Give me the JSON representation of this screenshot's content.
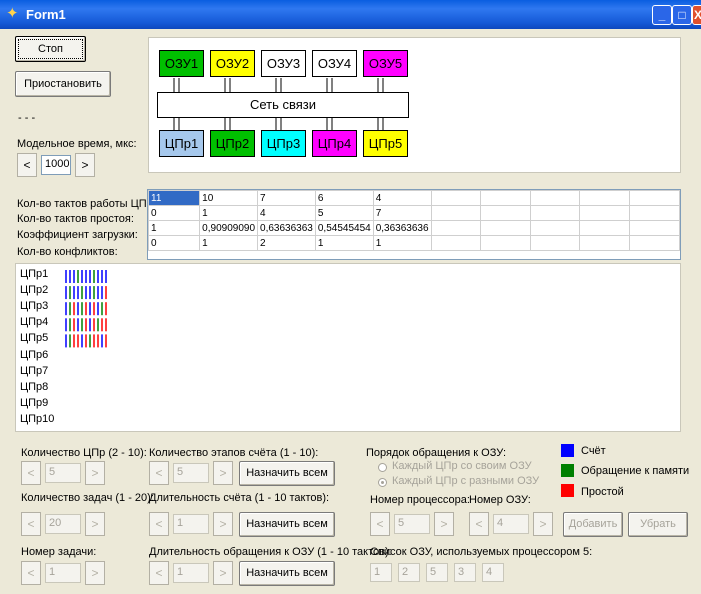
{
  "window": {
    "title": "Form1",
    "min": "_",
    "max": "□",
    "close": "X"
  },
  "controls": {
    "stop": "Стоп",
    "pause": "Приостановить",
    "dashes": "- - -",
    "model_time_label": "Модельное время, мкс:",
    "model_time_value": "1000",
    "dec": "<",
    "inc": ">"
  },
  "diagram": {
    "ram": [
      "ОЗУ1",
      "ОЗУ2",
      "ОЗУ3",
      "ОЗУ4",
      "ОЗУ5"
    ],
    "ram_colors": [
      "#00c000",
      "#ffff00",
      "#ffffff",
      "#ffffff",
      "#ff00ff"
    ],
    "network": "Сеть связи",
    "cpu": [
      "ЦПр1",
      "ЦПр2",
      "ЦПр3",
      "ЦПр4",
      "ЦПр5"
    ],
    "cpu_colors": [
      "#a6c8ec",
      "#00c000",
      "#00ffff",
      "#ff00ff",
      "#ffff00"
    ]
  },
  "stats": {
    "row_labels": [
      "Кол-во тактов работы ЦПр:",
      "Кол-во тактов простоя:",
      "Коэффициент загрузки:",
      "Кол-во конфликтов:"
    ],
    "rows": [
      [
        "11",
        "10",
        "7",
        "6",
        "4",
        "",
        "",
        "",
        "",
        ""
      ],
      [
        "0",
        "1",
        "4",
        "5",
        "7",
        "",
        "",
        "",
        "",
        ""
      ],
      [
        "1",
        "0,90909090",
        "0,63636363",
        "0,54545454",
        "0,36363636",
        "",
        "",
        "",
        "",
        ""
      ],
      [
        "0",
        "1",
        "2",
        "1",
        "1",
        "",
        "",
        "",
        "",
        ""
      ]
    ]
  },
  "timeline": {
    "labels": [
      "ЦПр1",
      "ЦПр2",
      "ЦПр3",
      "ЦПр4",
      "ЦПр5",
      "ЦПр6",
      "ЦПр7",
      "ЦПр8",
      "ЦПр9",
      "ЦПр10"
    ],
    "sequences": [
      [
        "c",
        "c",
        "c",
        "m",
        "c",
        "c",
        "c",
        "m",
        "c",
        "c",
        "c"
      ],
      [
        "c",
        "m",
        "c",
        "c",
        "m",
        "c",
        "c",
        "m",
        "c",
        "c",
        "i"
      ],
      [
        "c",
        "m",
        "i",
        "c",
        "m",
        "i",
        "c",
        "i",
        "c",
        "m",
        "i"
      ],
      [
        "c",
        "m",
        "i",
        "c",
        "m",
        "i",
        "c",
        "i",
        "m",
        "i",
        "i"
      ],
      [
        "c",
        "m",
        "i",
        "i",
        "c",
        "i",
        "m",
        "i",
        "i",
        "c",
        "i"
      ]
    ]
  },
  "legend": [
    {
      "label": "Счёт",
      "color": "#0000ff"
    },
    {
      "label": "Обращение к памяти",
      "color": "#008000"
    },
    {
      "label": "Простой",
      "color": "#ff0000"
    }
  ],
  "settings": {
    "cpu_count_label": "Количество ЦПр (2 - 10):",
    "cpu_count": "5",
    "task_count_label": "Количество задач (1 - 20):",
    "task_count": "20",
    "task_num_label": "Номер задачи:",
    "task_num": "1",
    "stages_label": "Количество этапов счёта (1 - 10):",
    "stages": "5",
    "calc_dur_label": "Длительность счёта (1 - 10 тактов):",
    "calc_dur": "1",
    "mem_dur_label": "Длительность обращения к ОЗУ (1 - 10 тактов):",
    "mem_dur": "1",
    "assign_all": "Назначить всем",
    "order_label": "Порядок обращения к ОЗУ:",
    "order_opt1": "Каждый ЦПр со своим ОЗУ",
    "order_opt2": "Каждый ЦПр с разными ОЗУ",
    "proc_num_label": "Номер процессора:",
    "proc_num": "5",
    "ram_num_label": "Номер ОЗУ:",
    "ram_num": "4",
    "add": "Добавить",
    "remove": "Убрать",
    "ram_list_label": "Список ОЗУ, используемых процессором 5:",
    "ram_list": [
      "1",
      "2",
      "5",
      "3",
      "4"
    ]
  }
}
